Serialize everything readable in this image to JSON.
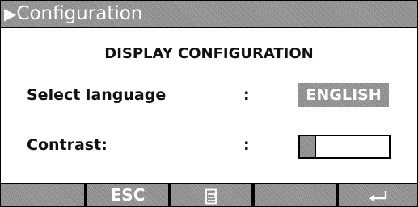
{
  "titlebar": {
    "arrow_icon": "play-triangle-icon",
    "title": "Configuration"
  },
  "heading": "DISPLAY CONFIGURATION",
  "settings": {
    "language": {
      "label": "Select language",
      "separator": ":",
      "value": "ENGLISH"
    },
    "contrast": {
      "label": "Contrast:",
      "separator": ":",
      "level": 0.18
    }
  },
  "softkeys": [
    {
      "id": "f1",
      "label": ""
    },
    {
      "id": "f2",
      "label": "ESC"
    },
    {
      "id": "f3",
      "label": "",
      "icon": "list-scroll-icon"
    },
    {
      "id": "f4",
      "label": ""
    },
    {
      "id": "f5",
      "label": "",
      "icon": "enter-return-icon"
    }
  ],
  "colors": {
    "panel_gray": "#949494",
    "text_dark": "#111111",
    "text_light": "#ffffff",
    "border": "#000000"
  }
}
